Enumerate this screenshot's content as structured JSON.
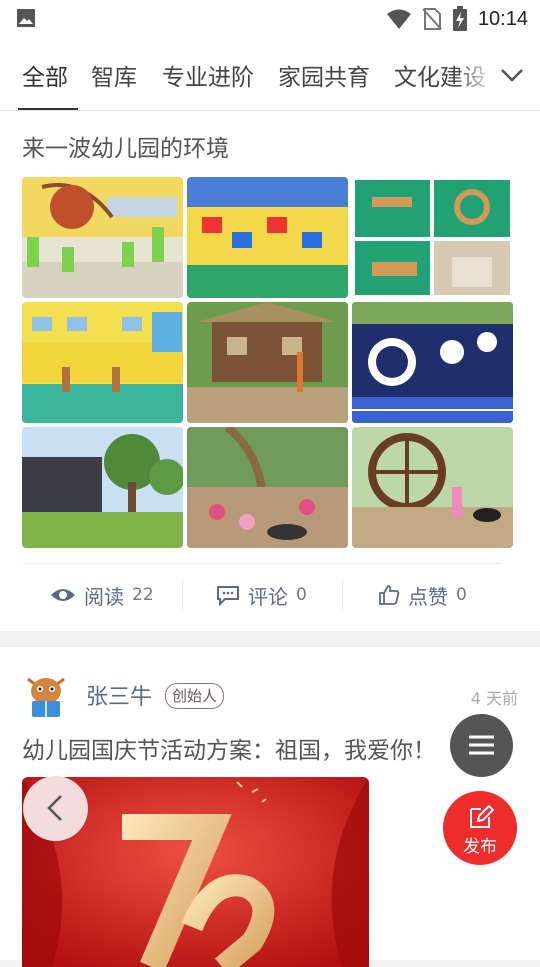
{
  "status_bar": {
    "time": "10:14"
  },
  "tabs": [
    "全部",
    "智库",
    "专业进阶",
    "家园共育",
    "文化建设"
  ],
  "post1": {
    "title": "来一波幼儿园的环境",
    "actions": [
      {
        "label": "阅读",
        "count": "22",
        "icon": "eye-icon"
      },
      {
        "label": "评论",
        "count": "0",
        "icon": "comment-icon"
      },
      {
        "label": "点赞",
        "count": "0",
        "icon": "thumbs-up-icon"
      }
    ]
  },
  "post2": {
    "author": "张三牛",
    "badge": "创始人",
    "time": "4 天前",
    "title": "幼儿园国庆节活动方案：祖国，我爱你！"
  },
  "fab": {
    "publish_label": "发布"
  },
  "colors": {
    "accent_red": "#ef2c2c",
    "link_blue": "#5a6a85"
  }
}
